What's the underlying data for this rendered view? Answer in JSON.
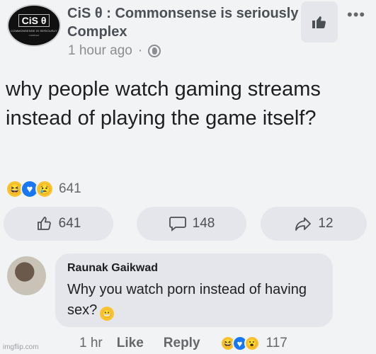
{
  "header": {
    "logo_text": "CiS θ",
    "logo_sub": "COMMONSENSE IS SERIOUSLY",
    "logo_sub2": "COMPLEX",
    "page_name": "CiS θ  : Commonsense is seriously Complex",
    "time": "1 hour ago",
    "separator": "·",
    "like_page_icon": "thumbs-up-icon",
    "more_label": "•••"
  },
  "post": {
    "text": "why people watch gaming streams instead of playing the game itself?"
  },
  "reactions": {
    "icons": [
      "haha-icon",
      "love-icon",
      "sad-icon"
    ],
    "count": "641"
  },
  "actions": {
    "like_count": "641",
    "comment_count": "148",
    "share_count": "12"
  },
  "comment": {
    "author": "Raunak Gaikwad",
    "text": "Why you watch porn instead of having sex?",
    "time": "1 hr",
    "like_label": "Like",
    "reply_label": "Reply",
    "reaction_count": "117"
  },
  "watermark": "imgflip.com",
  "colors": {
    "background": "#f2f3f5",
    "pill": "#e4e6eb",
    "text": "#1c1e21",
    "muted": "#65676b",
    "love": "#1877f2",
    "emoji": "#f7c330"
  }
}
